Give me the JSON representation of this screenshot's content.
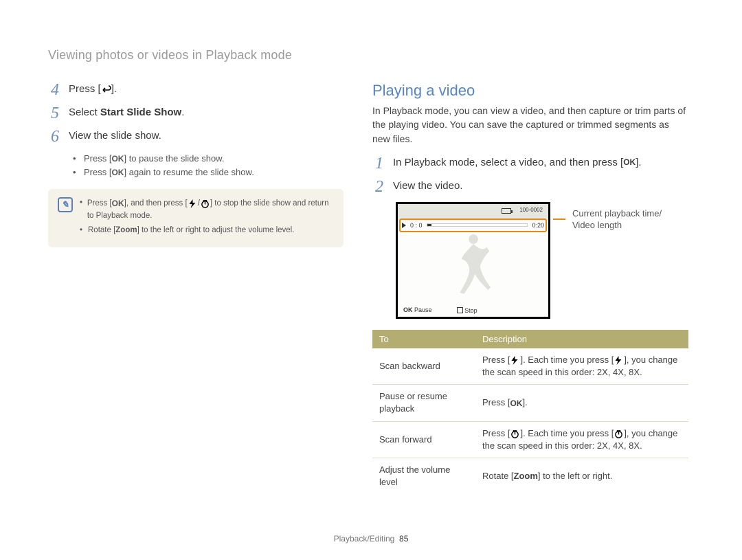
{
  "breadcrumb": "Viewing photos or videos in Playback mode",
  "left": {
    "step4": {
      "num": "4",
      "text_pre": "Press [",
      "text_post": "]."
    },
    "step5": {
      "num": "5",
      "text_pre": "Select ",
      "strong": "Start Slide Show",
      "text_post": "."
    },
    "step6": {
      "num": "6",
      "text": "View the slide show."
    },
    "sub1_pre": "Press [",
    "sub1_post": "] to pause the slide show.",
    "sub2_pre": "Press [",
    "sub2_post": "] again to resume the slide show.",
    "note1_pre": "Press [",
    "note1_mid1": "], and then press [",
    "note1_mid2": "/",
    "note1_post": "] to stop the slide show and return to Playback mode.",
    "note2_pre": "Rotate [",
    "note2_strong": "Zoom",
    "note2_post": "] to the left or right to adjust the volume level."
  },
  "right": {
    "heading": "Playing a video",
    "intro": "In Playback mode, you can view a video, and then capture or trim parts of the playing video. You can save the captured or trimmed segments as new files.",
    "step1": {
      "num": "1",
      "pre": "In Playback mode, select a video, and then press [",
      "post": "]."
    },
    "step2": {
      "num": "2",
      "text": "View the video."
    },
    "screen": {
      "file_counter": "100-0002",
      "playtime": "0 : 0",
      "duration": "0:20",
      "pause_label": "Pause",
      "stop_label": "Stop"
    },
    "annot_line1": "Current playback time/",
    "annot_line2": "Video length",
    "table": {
      "h1": "To",
      "h2": "Description",
      "r1": {
        "label": "Scan backward",
        "pre": "Press [",
        "mid": "]. Each time you press [",
        "post": "], you change the scan speed in this order: 2X, 4X, 8X."
      },
      "r2": {
        "label": "Pause or resume playback",
        "pre": "Press [",
        "post": "]."
      },
      "r3": {
        "label": "Scan forward",
        "pre": "Press [",
        "mid": "]. Each time you press [",
        "post": "], you change the scan speed in this order: 2X, 4X, 8X."
      },
      "r4": {
        "label": "Adjust the volume level",
        "pre": "Rotate [",
        "strong": "Zoom",
        "post": "] to the left or right."
      }
    }
  },
  "footer": {
    "section": "Playback/Editing",
    "page": "85"
  }
}
